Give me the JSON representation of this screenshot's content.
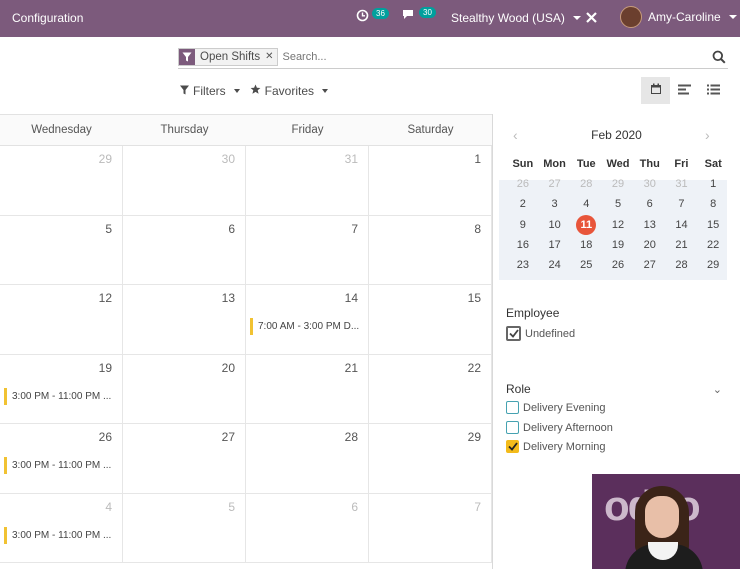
{
  "topbar": {
    "menu_label": "Configuration",
    "activities_count": "36",
    "messages_count": "30",
    "company": "Stealthy Wood (USA)",
    "user": "Amy-Caroline"
  },
  "search": {
    "facet_label": "Open Shifts",
    "placeholder": "Search..."
  },
  "toolbar": {
    "filters_label": "Filters",
    "favorites_label": "Favorites"
  },
  "calendar": {
    "day_names": [
      "Wednesday",
      "Thursday",
      "Friday",
      "Saturday"
    ],
    "weeks": [
      [
        {
          "d": "29",
          "m": true
        },
        {
          "d": "30",
          "m": true
        },
        {
          "d": "31",
          "m": true
        },
        {
          "d": "1",
          "m": false
        }
      ],
      [
        {
          "d": "5"
        },
        {
          "d": "6"
        },
        {
          "d": "7"
        },
        {
          "d": "8"
        }
      ],
      [
        {
          "d": "12"
        },
        {
          "d": "13"
        },
        {
          "d": "14",
          "event": "7:00 AM - 3:00 PM D..."
        },
        {
          "d": "15"
        }
      ],
      [
        {
          "d": "19",
          "event": "3:00 PM - 11:00 PM ..."
        },
        {
          "d": "20"
        },
        {
          "d": "21"
        },
        {
          "d": "22"
        }
      ],
      [
        {
          "d": "26",
          "event": "3:00 PM - 11:00 PM ..."
        },
        {
          "d": "27"
        },
        {
          "d": "28"
        },
        {
          "d": "29"
        }
      ],
      [
        {
          "d": "4",
          "m": true,
          "event": "3:00 PM - 11:00 PM ..."
        },
        {
          "d": "5",
          "m": true
        },
        {
          "d": "6",
          "m": true
        },
        {
          "d": "7",
          "m": true
        }
      ]
    ]
  },
  "mini_calendar": {
    "title": "Feb 2020",
    "weekdays": [
      "Sun",
      "Mon",
      "Tue",
      "Wed",
      "Thu",
      "Fri",
      "Sat"
    ],
    "rows": [
      [
        "26",
        "27",
        "28",
        "29",
        "30",
        "31",
        "1"
      ],
      [
        "2",
        "3",
        "4",
        "5",
        "6",
        "7",
        "8"
      ],
      [
        "9",
        "10",
        "11",
        "12",
        "13",
        "14",
        "15"
      ],
      [
        "16",
        "17",
        "18",
        "19",
        "20",
        "21",
        "22"
      ],
      [
        "23",
        "24",
        "25",
        "26",
        "27",
        "28",
        "29"
      ]
    ],
    "today": "11"
  },
  "employee_filter": {
    "title": "Employee",
    "items": [
      {
        "label": "Undefined",
        "checked": true
      }
    ]
  },
  "role_filter": {
    "title": "Role",
    "items": [
      {
        "label": "Delivery Evening",
        "checked": false
      },
      {
        "label": "Delivery Afternoon",
        "checked": false
      },
      {
        "label": "Delivery Morning",
        "checked": true
      }
    ]
  },
  "video_overlay": {
    "logo_text": "odoo"
  },
  "colors": {
    "brand": "#7c5a7c",
    "event_border": "#f1c232",
    "today": "#e8553a",
    "badge": "#00a09d"
  }
}
